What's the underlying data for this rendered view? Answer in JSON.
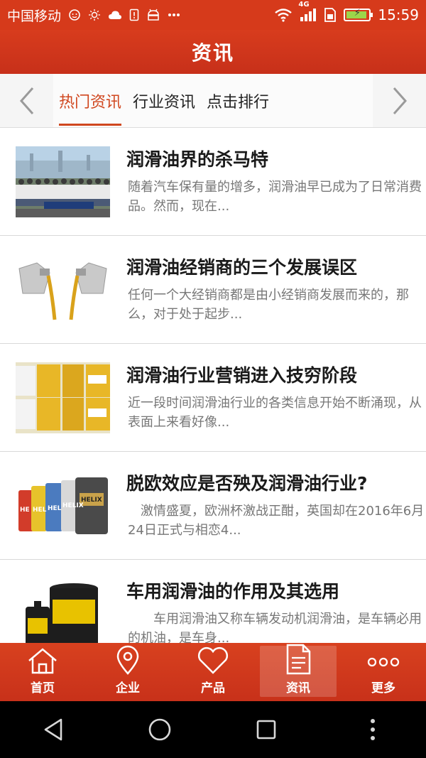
{
  "status_bar": {
    "carrier": "中国移动",
    "network": "4G",
    "time": "15:59",
    "icons_left": [
      "face-icon",
      "sun-icon",
      "cloud-icon",
      "sim-alert-icon",
      "android-icon",
      "more-dots-icon"
    ],
    "icons_right": [
      "wifi-icon",
      "signal-icon",
      "sim-card-icon",
      "battery-icon"
    ]
  },
  "header": {
    "title": "资讯"
  },
  "tabs": [
    {
      "label": "热门资讯",
      "active": true
    },
    {
      "label": "行业资讯",
      "active": false
    },
    {
      "label": "点击排行",
      "active": false
    }
  ],
  "articles": [
    {
      "title": "润滑油界的杀马特",
      "desc": "随着汽车保有量的增多，润滑油早已成为了日常消费品。然而，现在...",
      "thumb": "group-photo"
    },
    {
      "title": "润滑油经销商的三个发展误区",
      "desc": "任何一个大经销商都是由小经销商发展而来的，那么，对于处于起步...",
      "thumb": "oil-pouring"
    },
    {
      "title": "润滑油行业营销进入技穷阶段",
      "desc": "近一段时间润滑油行业的各类信息开始不断涌现，从表面上来看好像...",
      "thumb": "oil-barrels"
    },
    {
      "title": "脱欧效应是否殃及润滑油行业?",
      "desc": "　激情盛夏，欧洲杯激战正酣，英国却在2016年6月24日正式与相恋4...",
      "thumb": "helix-bottles"
    },
    {
      "title": "车用润滑油的作用及其选用",
      "desc": "　　车用润滑油又称车辆发动机润滑油，是车辆必用的机油，是车身...",
      "thumb": "oil-bucket"
    }
  ],
  "bottom_nav": [
    {
      "label": "首页",
      "icon": "home-icon",
      "active": false
    },
    {
      "label": "企业",
      "icon": "location-pin-icon",
      "active": false
    },
    {
      "label": "产品",
      "icon": "heart-icon",
      "active": false
    },
    {
      "label": "资讯",
      "icon": "document-icon",
      "active": true
    },
    {
      "label": "更多",
      "icon": "more-icon",
      "active": false
    }
  ],
  "colors": {
    "brand": "#d63a1b",
    "accent_tab": "#d0471f"
  }
}
